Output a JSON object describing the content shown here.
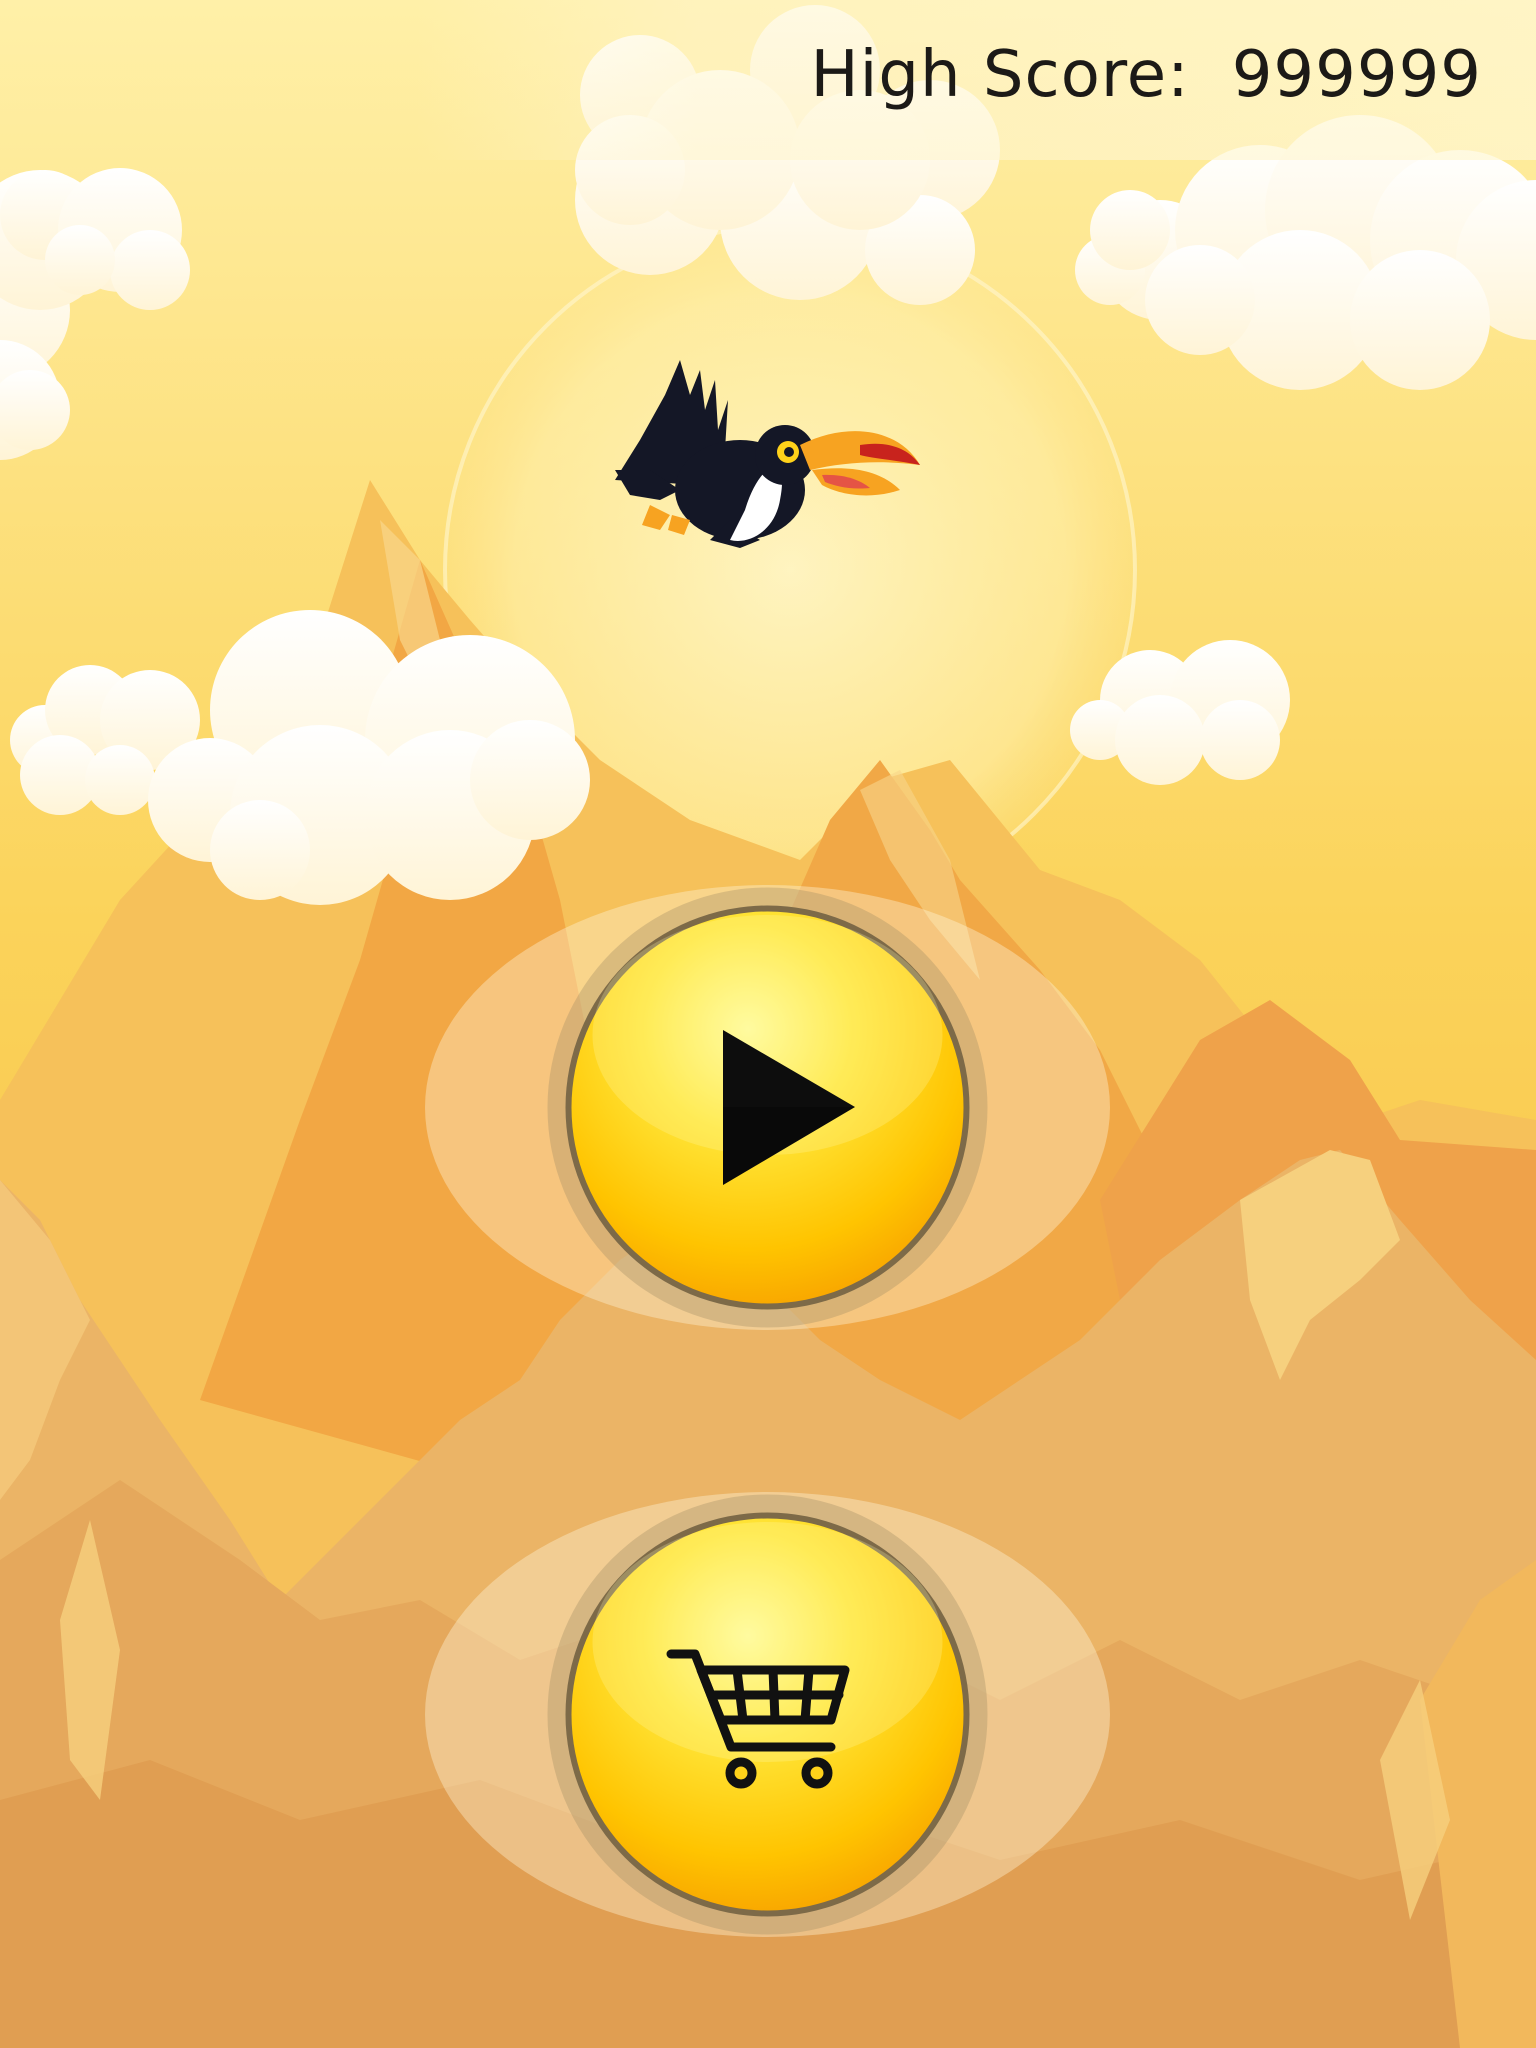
{
  "hud": {
    "high_score_label": "High Score:",
    "high_score_value": "999999"
  },
  "menu": {
    "play_icon": "play-icon",
    "shop_icon": "shopping-cart-icon"
  },
  "colors": {
    "sky_top": "#fff3b0",
    "sky_bottom": "#f7b733",
    "mountain_far": "#f3a845",
    "mountain_near": "#e9b060",
    "button_yellow": "#ffd21a",
    "button_ring": "#8e7a54",
    "text": "#1c1a17"
  }
}
